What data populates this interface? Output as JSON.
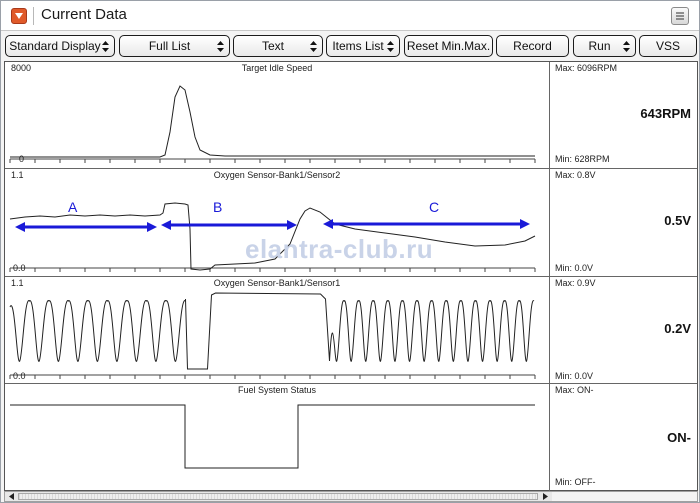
{
  "window": {
    "title": "Current Data"
  },
  "toolbar": {
    "buttons": [
      {
        "label": "Standard Display",
        "arrow": true
      },
      {
        "label": "Full List",
        "arrow": true
      },
      {
        "label": "Text",
        "arrow": true
      },
      {
        "label": "Items List",
        "arrow": true
      },
      {
        "label": "Reset Min.Max.",
        "arrow": false
      },
      {
        "label": "Record",
        "arrow": false
      },
      {
        "label": "Run",
        "arrow": true
      },
      {
        "label": "VSS",
        "arrow": false
      }
    ]
  },
  "graphs": [
    {
      "name": "Target Idle Speed",
      "y_max_label": "8000",
      "y_min_label": "0",
      "max": "Max:  6096RPM",
      "min": "Min:   628RPM",
      "current": "643RPM"
    },
    {
      "name": "Oxygen Sensor-Bank1/Sensor2",
      "y_max_label": "1.1",
      "y_min_label": "0.0",
      "max": "Max:   0.8V",
      "min": "Min:   0.0V",
      "current": "0.5V"
    },
    {
      "name": "Oxygen Sensor-Bank1/Sensor1",
      "y_max_label": "1.1",
      "y_min_label": "0.0",
      "max": "Max:   0.9V",
      "min": "Min:   0.0V",
      "current": "0.2V"
    },
    {
      "name": "Fuel System Status",
      "y_max_label": "",
      "y_min_label": "",
      "max": "Max: ON-",
      "min": "Min: OFF-",
      "current": "ON-"
    }
  ],
  "annotations": {
    "a": "A",
    "b": "B",
    "c": "C",
    "color": "#1a1ad8"
  },
  "watermark": "elantra-club.ru",
  "colors": {
    "title_icon": "#e05a2a",
    "trace": "#222222",
    "arrow": "#1a1ad8"
  }
}
